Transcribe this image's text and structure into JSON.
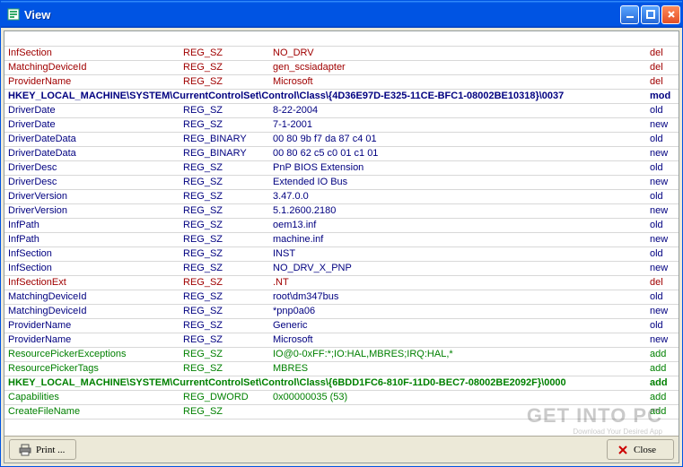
{
  "window": {
    "title": "View"
  },
  "rows": [
    {
      "name": "",
      "type": "",
      "value": "",
      "action": "",
      "cls": "c-del"
    },
    {
      "name": "InfSection",
      "type": "REG_SZ",
      "value": "NO_DRV",
      "action": "del",
      "cls": "c-del"
    },
    {
      "name": "MatchingDeviceId",
      "type": "REG_SZ",
      "value": "gen_scsiadapter",
      "action": "del",
      "cls": "c-del"
    },
    {
      "name": "ProviderName",
      "type": "REG_SZ",
      "value": "Microsoft",
      "action": "del",
      "cls": "c-del"
    },
    {
      "name": "HKEY_LOCAL_MACHINE\\SYSTEM\\CurrentControlSet\\Control\\Class\\{4D36E97D-E325-11CE-BFC1-08002BE10318}\\0037",
      "type": "",
      "value": "",
      "action": "mod",
      "cls": "c-mod",
      "span": true
    },
    {
      "name": "DriverDate",
      "type": "REG_SZ",
      "value": "8-22-2004",
      "action": "old",
      "cls": "c-old"
    },
    {
      "name": "DriverDate",
      "type": "REG_SZ",
      "value": "7-1-2001",
      "action": "new",
      "cls": "c-new"
    },
    {
      "name": "DriverDateData",
      "type": "REG_BINARY",
      "value": "00 80 9b f7 da 87 c4 01",
      "action": "old",
      "cls": "c-old"
    },
    {
      "name": "DriverDateData",
      "type": "REG_BINARY",
      "value": "00 80 62 c5 c0 01 c1 01",
      "action": "new",
      "cls": "c-new"
    },
    {
      "name": "DriverDesc",
      "type": "REG_SZ",
      "value": "PnP BIOS Extension",
      "action": "old",
      "cls": "c-old"
    },
    {
      "name": "DriverDesc",
      "type": "REG_SZ",
      "value": "Extended IO Bus",
      "action": "new",
      "cls": "c-new"
    },
    {
      "name": "DriverVersion",
      "type": "REG_SZ",
      "value": "3.47.0.0",
      "action": "old",
      "cls": "c-old"
    },
    {
      "name": "DriverVersion",
      "type": "REG_SZ",
      "value": "5.1.2600.2180",
      "action": "new",
      "cls": "c-new"
    },
    {
      "name": "InfPath",
      "type": "REG_SZ",
      "value": "oem13.inf",
      "action": "old",
      "cls": "c-old"
    },
    {
      "name": "InfPath",
      "type": "REG_SZ",
      "value": "machine.inf",
      "action": "new",
      "cls": "c-new"
    },
    {
      "name": "InfSection",
      "type": "REG_SZ",
      "value": "INST",
      "action": "old",
      "cls": "c-old"
    },
    {
      "name": "InfSection",
      "type": "REG_SZ",
      "value": "NO_DRV_X_PNP",
      "action": "new",
      "cls": "c-new"
    },
    {
      "name": "InfSectionExt",
      "type": "REG_SZ",
      "value": ".NT",
      "action": "del",
      "cls": "c-del"
    },
    {
      "name": "MatchingDeviceId",
      "type": "REG_SZ",
      "value": "root\\dm347bus",
      "action": "old",
      "cls": "c-old"
    },
    {
      "name": "MatchingDeviceId",
      "type": "REG_SZ",
      "value": "*pnp0a06",
      "action": "new",
      "cls": "c-new"
    },
    {
      "name": "ProviderName",
      "type": "REG_SZ",
      "value": "Generic",
      "action": "old",
      "cls": "c-old"
    },
    {
      "name": "ProviderName",
      "type": "REG_SZ",
      "value": "Microsoft",
      "action": "new",
      "cls": "c-new"
    },
    {
      "name": "ResourcePickerExceptions",
      "type": "REG_SZ",
      "value": "IO@0-0xFF:*;IO:HAL,MBRES;IRQ:HAL,*",
      "action": "add",
      "cls": "c-add"
    },
    {
      "name": "ResourcePickerTags",
      "type": "REG_SZ",
      "value": "MBRES",
      "action": "add",
      "cls": "c-add"
    },
    {
      "name": "HKEY_LOCAL_MACHINE\\SYSTEM\\CurrentControlSet\\Control\\Class\\{6BDD1FC6-810F-11D0-BEC7-08002BE2092F}\\0000",
      "type": "",
      "value": "",
      "action": "add",
      "cls": "c-addh",
      "span": true
    },
    {
      "name": "Capabilities",
      "type": "REG_DWORD",
      "value": "0x00000035 (53)",
      "action": "add",
      "cls": "c-add"
    },
    {
      "name": "CreateFileName",
      "type": "REG_SZ",
      "value": "",
      "action": "add",
      "cls": "c-add"
    }
  ],
  "footer": {
    "print_label": "Print ...",
    "close_label": "Close"
  },
  "watermark": {
    "line1": "GET INTO PC",
    "line2": "Download Your Desired App"
  }
}
